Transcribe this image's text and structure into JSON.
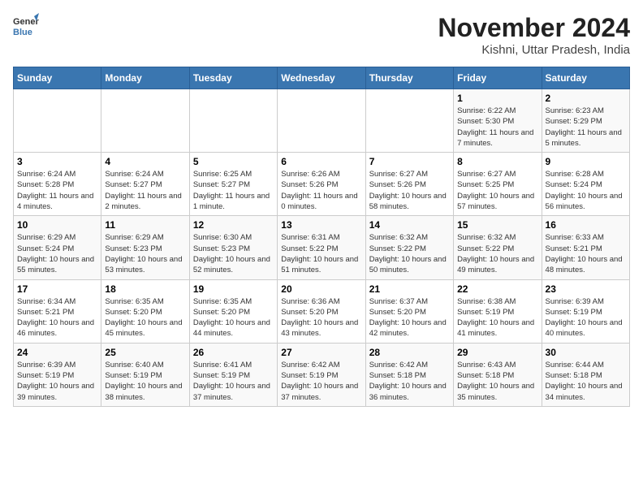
{
  "header": {
    "logo_line1": "General",
    "logo_line2": "Blue",
    "month_title": "November 2024",
    "subtitle": "Kishni, Uttar Pradesh, India"
  },
  "calendar": {
    "weekdays": [
      "Sunday",
      "Monday",
      "Tuesday",
      "Wednesday",
      "Thursday",
      "Friday",
      "Saturday"
    ],
    "weeks": [
      [
        {
          "day": "",
          "info": ""
        },
        {
          "day": "",
          "info": ""
        },
        {
          "day": "",
          "info": ""
        },
        {
          "day": "",
          "info": ""
        },
        {
          "day": "",
          "info": ""
        },
        {
          "day": "1",
          "info": "Sunrise: 6:22 AM\nSunset: 5:30 PM\nDaylight: 11 hours and 7 minutes."
        },
        {
          "day": "2",
          "info": "Sunrise: 6:23 AM\nSunset: 5:29 PM\nDaylight: 11 hours and 5 minutes."
        }
      ],
      [
        {
          "day": "3",
          "info": "Sunrise: 6:24 AM\nSunset: 5:28 PM\nDaylight: 11 hours and 4 minutes."
        },
        {
          "day": "4",
          "info": "Sunrise: 6:24 AM\nSunset: 5:27 PM\nDaylight: 11 hours and 2 minutes."
        },
        {
          "day": "5",
          "info": "Sunrise: 6:25 AM\nSunset: 5:27 PM\nDaylight: 11 hours and 1 minute."
        },
        {
          "day": "6",
          "info": "Sunrise: 6:26 AM\nSunset: 5:26 PM\nDaylight: 11 hours and 0 minutes."
        },
        {
          "day": "7",
          "info": "Sunrise: 6:27 AM\nSunset: 5:26 PM\nDaylight: 10 hours and 58 minutes."
        },
        {
          "day": "8",
          "info": "Sunrise: 6:27 AM\nSunset: 5:25 PM\nDaylight: 10 hours and 57 minutes."
        },
        {
          "day": "9",
          "info": "Sunrise: 6:28 AM\nSunset: 5:24 PM\nDaylight: 10 hours and 56 minutes."
        }
      ],
      [
        {
          "day": "10",
          "info": "Sunrise: 6:29 AM\nSunset: 5:24 PM\nDaylight: 10 hours and 55 minutes."
        },
        {
          "day": "11",
          "info": "Sunrise: 6:29 AM\nSunset: 5:23 PM\nDaylight: 10 hours and 53 minutes."
        },
        {
          "day": "12",
          "info": "Sunrise: 6:30 AM\nSunset: 5:23 PM\nDaylight: 10 hours and 52 minutes."
        },
        {
          "day": "13",
          "info": "Sunrise: 6:31 AM\nSunset: 5:22 PM\nDaylight: 10 hours and 51 minutes."
        },
        {
          "day": "14",
          "info": "Sunrise: 6:32 AM\nSunset: 5:22 PM\nDaylight: 10 hours and 50 minutes."
        },
        {
          "day": "15",
          "info": "Sunrise: 6:32 AM\nSunset: 5:22 PM\nDaylight: 10 hours and 49 minutes."
        },
        {
          "day": "16",
          "info": "Sunrise: 6:33 AM\nSunset: 5:21 PM\nDaylight: 10 hours and 48 minutes."
        }
      ],
      [
        {
          "day": "17",
          "info": "Sunrise: 6:34 AM\nSunset: 5:21 PM\nDaylight: 10 hours and 46 minutes."
        },
        {
          "day": "18",
          "info": "Sunrise: 6:35 AM\nSunset: 5:20 PM\nDaylight: 10 hours and 45 minutes."
        },
        {
          "day": "19",
          "info": "Sunrise: 6:35 AM\nSunset: 5:20 PM\nDaylight: 10 hours and 44 minutes."
        },
        {
          "day": "20",
          "info": "Sunrise: 6:36 AM\nSunset: 5:20 PM\nDaylight: 10 hours and 43 minutes."
        },
        {
          "day": "21",
          "info": "Sunrise: 6:37 AM\nSunset: 5:20 PM\nDaylight: 10 hours and 42 minutes."
        },
        {
          "day": "22",
          "info": "Sunrise: 6:38 AM\nSunset: 5:19 PM\nDaylight: 10 hours and 41 minutes."
        },
        {
          "day": "23",
          "info": "Sunrise: 6:39 AM\nSunset: 5:19 PM\nDaylight: 10 hours and 40 minutes."
        }
      ],
      [
        {
          "day": "24",
          "info": "Sunrise: 6:39 AM\nSunset: 5:19 PM\nDaylight: 10 hours and 39 minutes."
        },
        {
          "day": "25",
          "info": "Sunrise: 6:40 AM\nSunset: 5:19 PM\nDaylight: 10 hours and 38 minutes."
        },
        {
          "day": "26",
          "info": "Sunrise: 6:41 AM\nSunset: 5:19 PM\nDaylight: 10 hours and 37 minutes."
        },
        {
          "day": "27",
          "info": "Sunrise: 6:42 AM\nSunset: 5:19 PM\nDaylight: 10 hours and 37 minutes."
        },
        {
          "day": "28",
          "info": "Sunrise: 6:42 AM\nSunset: 5:18 PM\nDaylight: 10 hours and 36 minutes."
        },
        {
          "day": "29",
          "info": "Sunrise: 6:43 AM\nSunset: 5:18 PM\nDaylight: 10 hours and 35 minutes."
        },
        {
          "day": "30",
          "info": "Sunrise: 6:44 AM\nSunset: 5:18 PM\nDaylight: 10 hours and 34 minutes."
        }
      ]
    ]
  }
}
